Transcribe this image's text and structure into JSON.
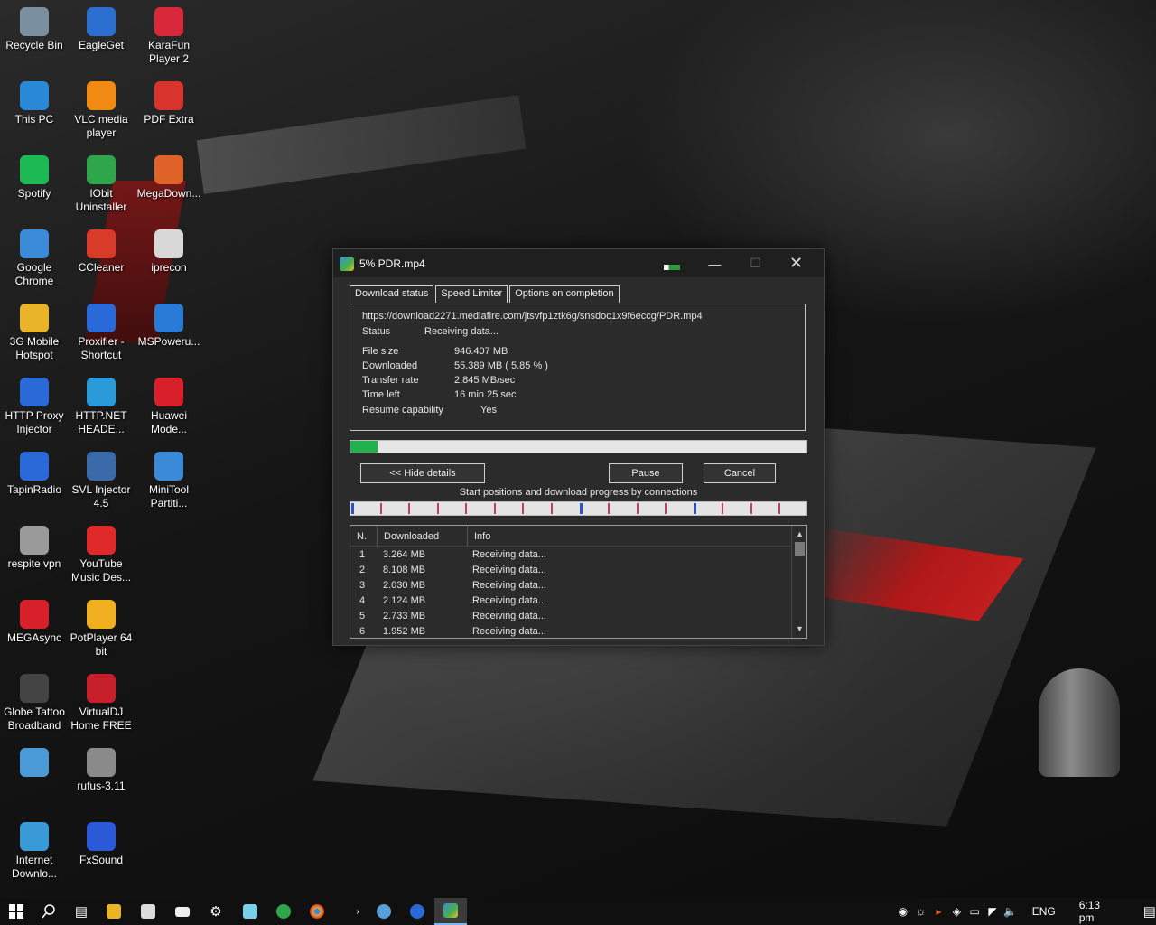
{
  "desktop": {
    "icons": [
      {
        "label": "Recycle Bin",
        "icon": "recycle-bin-icon",
        "color": "#7a8fa0"
      },
      {
        "label": "EagleGet",
        "icon": "eagleget-icon",
        "color": "#2c6fd1"
      },
      {
        "label": "KaraFun Player 2",
        "icon": "karafun-icon",
        "color": "#d9283a"
      },
      {
        "label": "This PC",
        "icon": "this-pc-icon",
        "color": "#2a88d8"
      },
      {
        "label": "VLC media player",
        "icon": "vlc-icon",
        "color": "#f08a12"
      },
      {
        "label": "PDF Extra",
        "icon": "pdf-extra-icon",
        "color": "#d8342c"
      },
      {
        "label": "Spotify",
        "icon": "spotify-icon",
        "color": "#1db954"
      },
      {
        "label": "IObit Uninstaller",
        "icon": "iobit-icon",
        "color": "#2fa64a"
      },
      {
        "label": "MegaDown...",
        "icon": "megadownloader-icon",
        "color": "#e0642a"
      },
      {
        "label": "Google Chrome",
        "icon": "chrome-icon",
        "color": "#3c8bd9"
      },
      {
        "label": "CCleaner",
        "icon": "ccleaner-icon",
        "color": "#d83b2a"
      },
      {
        "label": "iprecon",
        "icon": "iprecon-icon",
        "color": "#d8d8d8"
      },
      {
        "label": "3G Mobile Hotspot",
        "icon": "hotspot-icon",
        "color": "#e8b52a"
      },
      {
        "label": "Proxifier - Shortcut",
        "icon": "proxifier-icon",
        "color": "#2a6ad8"
      },
      {
        "label": "MSPoweru...",
        "icon": "mspoweruser-icon",
        "color": "#2a7ad8"
      },
      {
        "label": "HTTP Proxy Injector",
        "icon": "http-proxy-injector-icon",
        "color": "#2a6ad8"
      },
      {
        "label": "HTTP.NET HEADE...",
        "icon": "httpnet-icon",
        "color": "#2a9ad8"
      },
      {
        "label": "Huawei Mode...",
        "icon": "huawei-icon",
        "color": "#d8202a"
      },
      {
        "label": "TapinRadio",
        "icon": "tapinradio-icon",
        "color": "#2a6ad8"
      },
      {
        "label": "SVL Injector 4.5",
        "icon": "svl-injector-icon",
        "color": "#3a6aa8"
      },
      {
        "label": "MiniTool Partiti...",
        "icon": "minitool-icon",
        "color": "#3a8ad8"
      },
      {
        "label": "respite vpn",
        "icon": "respite-vpn-icon",
        "color": "#9a9a9a"
      },
      {
        "label": "YouTube Music Des...",
        "icon": "youtube-music-icon",
        "color": "#e02a2a"
      },
      {
        "label": "MEGAsync",
        "icon": "megasync-icon",
        "color": "#d8202a"
      },
      {
        "label": "PotPlayer 64 bit",
        "icon": "potplayer-icon",
        "color": "#f0b020"
      },
      {
        "label": "Globe Tattoo Broadband",
        "icon": "globe-tattoo-icon",
        "color": "#444444"
      },
      {
        "label": "VirtualDJ Home FREE",
        "icon": "virtualdj-icon",
        "color": "#c8202a"
      },
      {
        "label": "",
        "icon": "network-app-icon",
        "color": "#4a9ad8"
      },
      {
        "label": "rufus-3.11",
        "icon": "rufus-icon",
        "color": "#8a8a8a"
      },
      {
        "label": "Internet Downlo...",
        "icon": "internet-download-manager-icon",
        "color": "#3a9ad8"
      },
      {
        "label": "FxSound",
        "icon": "fxsound-icon",
        "color": "#2a5ad8"
      }
    ]
  },
  "window": {
    "title": "5% PDR.mp4",
    "tabs": [
      "Download status",
      "Speed Limiter",
      "Options on completion"
    ],
    "url": "https://download2271.mediafire.com/jtsvfp1ztk6g/snsdoc1x9f6eccg/PDR.mp4",
    "status_label": "Status",
    "status_value": "Receiving data...",
    "file_size_label": "File size",
    "file_size_value": "946.407  MB",
    "downloaded_label": "Downloaded",
    "downloaded_value": "55.389  MB  ( 5.85 % )",
    "transfer_rate_label": "Transfer rate",
    "transfer_rate_value": "2.845  MB/sec",
    "time_left_label": "Time left",
    "time_left_value": "16 min 25 sec",
    "resume_label": "Resume capability",
    "resume_value": "Yes",
    "progress_fraction": 0.0585,
    "hide_details_label": "<< Hide details",
    "pause_label": "Pause",
    "cancel_label": "Cancel",
    "connections_caption": "Start positions and download progress by connections",
    "connections_count": 16,
    "columns": [
      "N.",
      "Downloaded",
      "Info"
    ],
    "rows": [
      {
        "n": "1",
        "downloaded": "3.264  MB",
        "info": "Receiving data..."
      },
      {
        "n": "2",
        "downloaded": "8.108  MB",
        "info": "Receiving data..."
      },
      {
        "n": "3",
        "downloaded": "2.030  MB",
        "info": "Receiving data..."
      },
      {
        "n": "4",
        "downloaded": "2.124  MB",
        "info": "Receiving data..."
      },
      {
        "n": "5",
        "downloaded": "2.733  MB",
        "info": "Receiving data..."
      },
      {
        "n": "6",
        "downloaded": "1.952  MB",
        "info": "Receiving data..."
      }
    ]
  },
  "taskbar": {
    "language": "ENG",
    "time": "6:13 pm",
    "accent": "#76b9ed"
  }
}
